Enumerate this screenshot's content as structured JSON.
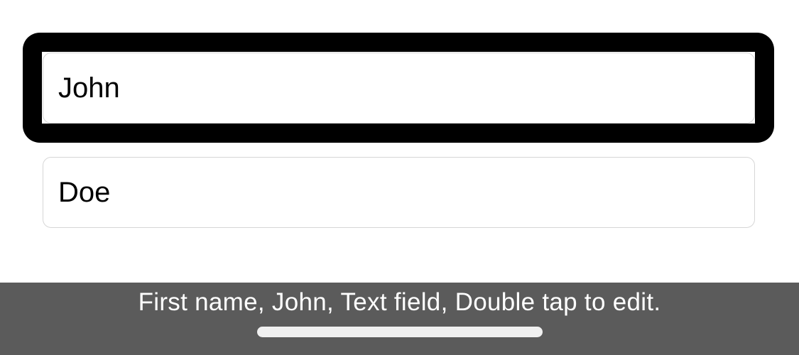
{
  "form": {
    "first_name": {
      "value": "John"
    },
    "last_name": {
      "value": "Doe"
    }
  },
  "voiceover": {
    "caption": "First name, John, Text field, Double tap to edit."
  },
  "colors": {
    "background": "#ffffff",
    "field_border": "#d6d6d6",
    "focus_ring": "#000000",
    "caption_panel": "#5b5b5b",
    "caption_text": "#ffffff",
    "home_indicator": "#f0f0f0"
  }
}
